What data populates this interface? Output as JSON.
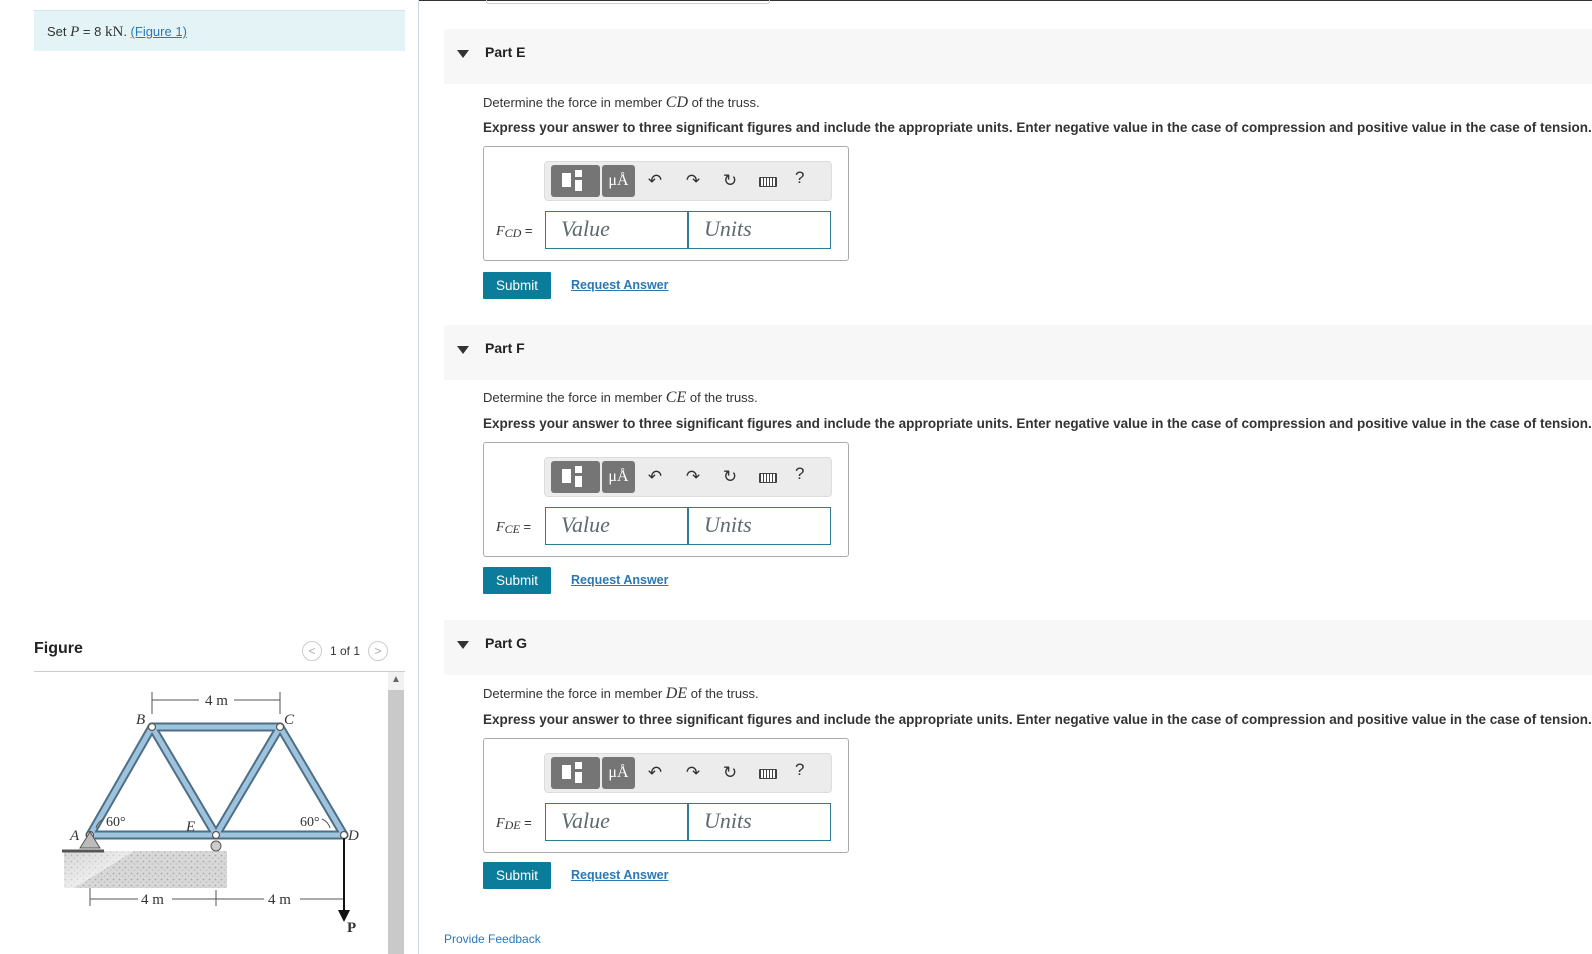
{
  "problem": {
    "prefix": "Set ",
    "var": "P",
    "mid": " = 8 ",
    "unit": "kN",
    "suffix": ". ",
    "link": "(Figure 1)"
  },
  "figure": {
    "title": "Figure",
    "pager": "1 of 1",
    "labels": {
      "A": "A",
      "B": "B",
      "C": "C",
      "D": "D",
      "E": "E",
      "P": "P",
      "dim_top": "4 m",
      "dim_left": "4 m",
      "dim_right": "4 m",
      "angle_left": "60°",
      "angle_right": "60°"
    }
  },
  "toolbar": {
    "mu": "μÅ",
    "undo": "↶",
    "redo": "↷",
    "reset": "↻",
    "help": "?"
  },
  "parts": [
    {
      "title": "Part E",
      "q_pre": "Determine the force in member ",
      "member": "CD",
      "q_post": " of the truss.",
      "instruction": "Express your answer to three significant figures and include the appropriate units. Enter negative value in the case of compression and positive value in the case of tension.",
      "label_main": "F",
      "label_sub": "CD",
      "label_eq": " =",
      "value_placeholder": "Value",
      "units_placeholder": "Units",
      "submit": "Submit",
      "request": "Request Answer"
    },
    {
      "title": "Part F",
      "q_pre": "Determine the force in member ",
      "member": "CE",
      "q_post": " of the truss.",
      "instruction": "Express your answer to three significant figures and include the appropriate units. Enter negative value in the case of compression and positive value in the case of tension.",
      "label_main": "F",
      "label_sub": "CE",
      "label_eq": " =",
      "value_placeholder": "Value",
      "units_placeholder": "Units",
      "submit": "Submit",
      "request": "Request Answer"
    },
    {
      "title": "Part G",
      "q_pre": "Determine the force in member ",
      "member": "DE",
      "q_post": " of the truss.",
      "instruction": "Express your answer to three significant figures and include the appropriate units. Enter negative value in the case of compression and positive value in the case of tension.",
      "label_main": "F",
      "label_sub": "DE",
      "label_eq": " =",
      "value_placeholder": "Value",
      "units_placeholder": "Units",
      "submit": "Submit",
      "request": "Request Answer"
    }
  ],
  "feedback": "Provide Feedback"
}
